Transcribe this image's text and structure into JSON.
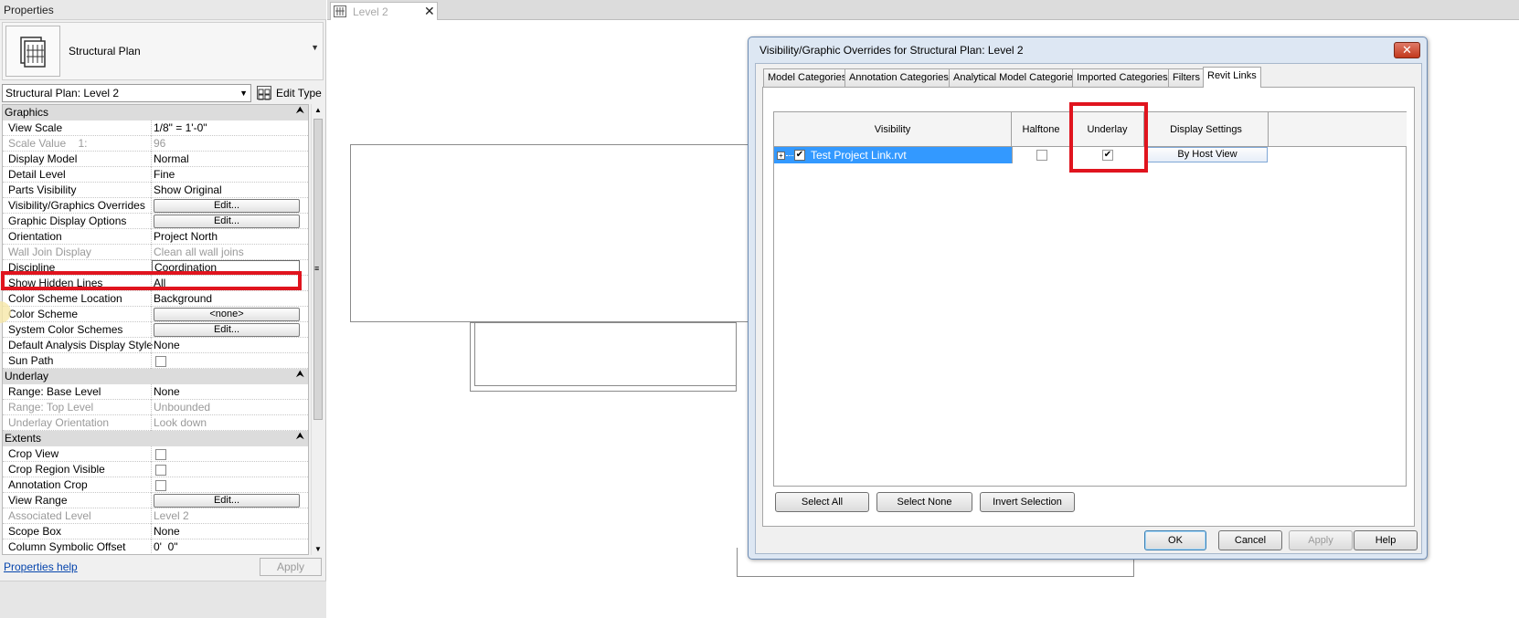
{
  "properties": {
    "title": "Properties",
    "type_name": "Structural Plan",
    "instance_selector": "Structural Plan: Level 2",
    "edit_type": "Edit Type",
    "help_link": "Properties help",
    "apply": "Apply",
    "groups": {
      "graphics": "Graphics",
      "underlay": "Underlay",
      "extents": "Extents"
    },
    "rows": {
      "view_scale": {
        "label": "View Scale",
        "value": "1/8\" = 1'-0\""
      },
      "scale_value": {
        "label": "Scale Value    1:",
        "value": "96"
      },
      "display_model": {
        "label": "Display Model",
        "value": "Normal"
      },
      "detail_level": {
        "label": "Detail Level",
        "value": "Fine"
      },
      "parts_visibility": {
        "label": "Parts Visibility",
        "value": "Show Original"
      },
      "vg_overrides": {
        "label": "Visibility/Graphics Overrides",
        "value": "Edit..."
      },
      "graphic_display": {
        "label": "Graphic Display Options",
        "value": "Edit..."
      },
      "orientation": {
        "label": "Orientation",
        "value": "Project North"
      },
      "wall_join": {
        "label": "Wall Join Display",
        "value": "Clean all wall joins"
      },
      "discipline": {
        "label": "Discipline",
        "value": "Coordination"
      },
      "show_hidden": {
        "label": "Show Hidden Lines",
        "value": "All"
      },
      "color_scheme_location": {
        "label": "Color Scheme Location",
        "value": "Background"
      },
      "color_scheme": {
        "label": "Color Scheme",
        "value": "<none>"
      },
      "system_color_schemes": {
        "label": "System Color Schemes",
        "value": "Edit..."
      },
      "default_analysis": {
        "label": "Default Analysis Display Style",
        "value": "None"
      },
      "sun_path": {
        "label": "Sun Path",
        "value": ""
      },
      "range_base": {
        "label": "Range: Base Level",
        "value": "None"
      },
      "range_top": {
        "label": "Range: Top Level",
        "value": "Unbounded"
      },
      "underlay_orientation": {
        "label": "Underlay Orientation",
        "value": "Look down"
      },
      "crop_view": {
        "label": "Crop View",
        "value": ""
      },
      "crop_region_visible": {
        "label": "Crop Region Visible",
        "value": ""
      },
      "annotation_crop": {
        "label": "Annotation Crop",
        "value": ""
      },
      "view_range": {
        "label": "View Range",
        "value": "Edit..."
      },
      "associated_level": {
        "label": "Associated Level",
        "value": "Level 2"
      },
      "scope_box": {
        "label": "Scope Box",
        "value": "None"
      },
      "column_offset": {
        "label": "Column Symbolic Offset",
        "value": "0'  0\""
      }
    }
  },
  "view_tab": {
    "label": "Level 2",
    "close": "✕"
  },
  "dialog": {
    "title": "Visibility/Graphic Overrides for Structural Plan: Level 2",
    "close": "✕",
    "tabs": [
      "Model Categories",
      "Annotation Categories",
      "Analytical Model Categories",
      "Imported Categories",
      "Filters",
      "Revit Links"
    ],
    "active_tab": "Revit Links",
    "columns": {
      "visibility": "Visibility",
      "halftone": "Halftone",
      "underlay": "Underlay",
      "display_settings": "Display Settings"
    },
    "link_row": {
      "name": "Test Project Link.rvt",
      "visible": true,
      "halftone": false,
      "underlay": true,
      "display_settings": "By Host View"
    },
    "buttons": {
      "select_all": "Select All",
      "select_none": "Select None",
      "invert_selection": "Invert Selection",
      "ok": "OK",
      "cancel": "Cancel",
      "apply": "Apply",
      "help": "Help"
    }
  },
  "colors": {
    "highlight": "#e0141e",
    "selection": "#3399ff",
    "dialog_frame": "#dde7f3"
  }
}
